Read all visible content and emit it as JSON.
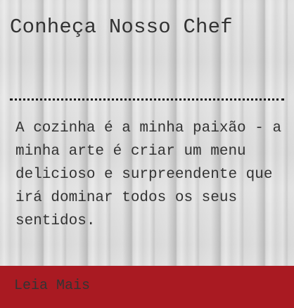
{
  "card": {
    "title": "Conheça Nosso Chef",
    "description": "A cozinha é a minha paixão - a minha arte é criar um menu delicioso e surpreendente que irá dominar todos os seus sentidos.",
    "read_more_label": "Leia Mais"
  },
  "colors": {
    "footer_background": "#a91a22",
    "text": "#333333",
    "background": "#dcdcdc"
  }
}
